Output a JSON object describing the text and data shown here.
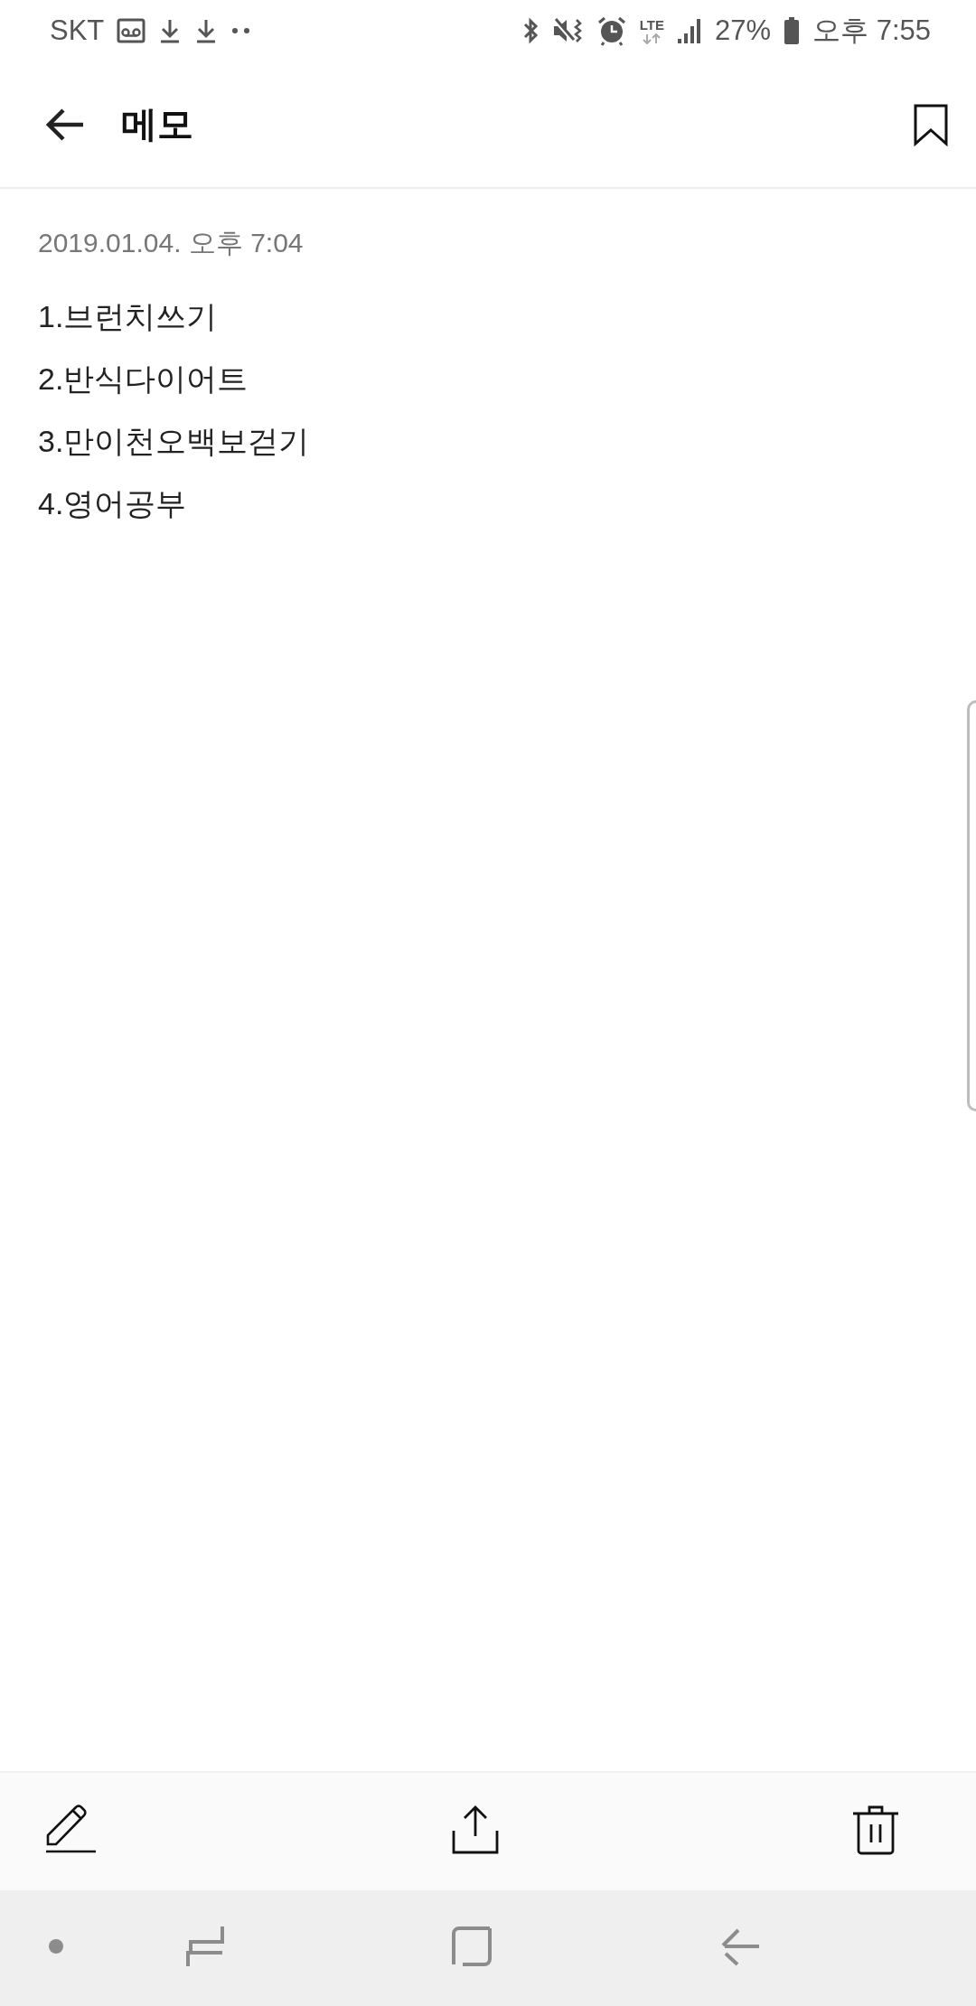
{
  "status_bar": {
    "carrier": "SKT",
    "network": "LTE",
    "battery": "27%",
    "time": "오후 7:55"
  },
  "app_bar": {
    "title": "메모"
  },
  "memo": {
    "date": "2019.01.04. 오후 7:04",
    "lines": [
      "1.브런치쓰기",
      "2.반식다이어트",
      "3.만이천오백보걷기",
      "4.영어공부"
    ]
  },
  "toolbar": {
    "actions": [
      {
        "kind": "edit"
      },
      {
        "kind": "share"
      },
      {
        "kind": "delete"
      }
    ]
  },
  "nav_bar": {
    "buttons": [
      {
        "kind": "dot"
      },
      {
        "kind": "recents"
      },
      {
        "kind": "home"
      },
      {
        "kind": "back"
      }
    ]
  }
}
